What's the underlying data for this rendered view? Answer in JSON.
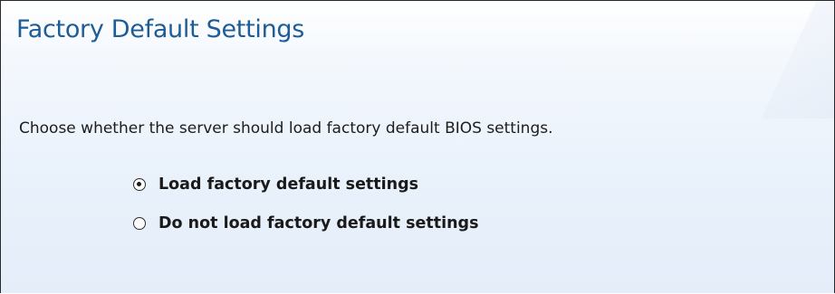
{
  "page": {
    "title": "Factory Default Settings",
    "description": "Choose whether the server should load factory default BIOS settings."
  },
  "options": [
    {
      "label": "Load factory default settings",
      "selected": true
    },
    {
      "label": "Do not load factory default settings",
      "selected": false
    }
  ],
  "colors": {
    "title": "#1e5c96",
    "background_top": "#ffffff",
    "background_bottom": "#e4edf9",
    "text": "#1d1d1d"
  },
  "icons": [
    "radio-checked-icon",
    "radio-unchecked-icon"
  ]
}
